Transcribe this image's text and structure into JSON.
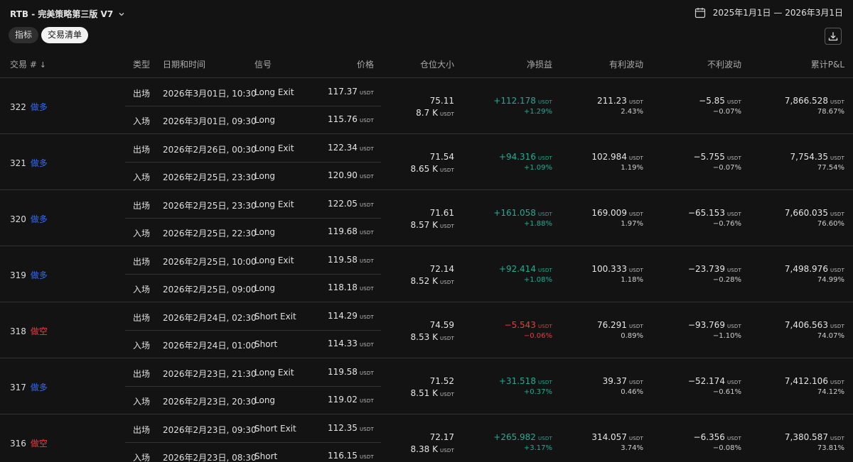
{
  "header": {
    "strategy_title": "RTB - 完美策略第三版 V7",
    "date_range": "2025年1月1日 — 2026年3月1日"
  },
  "tabs": [
    {
      "label": "指标",
      "active": false
    },
    {
      "label": "交易清单",
      "active": true
    }
  ],
  "unit": "USDT",
  "columns": {
    "trade_no": "交易 #",
    "type": "类型",
    "datetime": "日期和时间",
    "signal": "信号",
    "price": "价格",
    "size": "仓位大小",
    "net_pnl": "净损益",
    "favorable": "有利波动",
    "adverse": "不利波动",
    "cum_pnl": "累计P&L"
  },
  "colors": {
    "long": "#2f6bff",
    "short": "#f23645",
    "profit": "#22ab94",
    "loss": "#f23645"
  },
  "trades": [
    {
      "no": "322",
      "dir": "做多",
      "dir_class": "long",
      "exit": {
        "type": "出场",
        "datetime": "2026年3月01日, 10:30",
        "signal": "Long Exit",
        "price": "117.37"
      },
      "entry": {
        "type": "入场",
        "datetime": "2026年3月01日, 09:30",
        "signal": "Long",
        "price": "115.76"
      },
      "size_qty": "75.11",
      "size_value": "8.7 K",
      "net_pnl": "+112.178",
      "net_pnl_pct": "+1.29%",
      "pnl_class": "pos",
      "favorable": "211.23",
      "favorable_pct": "2.43%",
      "adverse": "−5.85",
      "adverse_pct": "−0.07%",
      "cum_pnl": "7,866.528",
      "cum_pnl_pct": "78.67%"
    },
    {
      "no": "321",
      "dir": "做多",
      "dir_class": "long",
      "exit": {
        "type": "出场",
        "datetime": "2026年2月26日, 00:30",
        "signal": "Long Exit",
        "price": "122.34"
      },
      "entry": {
        "type": "入场",
        "datetime": "2026年2月25日, 23:30",
        "signal": "Long",
        "price": "120.90"
      },
      "size_qty": "71.54",
      "size_value": "8.65 K",
      "net_pnl": "+94.316",
      "net_pnl_pct": "+1.09%",
      "pnl_class": "pos",
      "favorable": "102.984",
      "favorable_pct": "1.19%",
      "adverse": "−5.755",
      "adverse_pct": "−0.07%",
      "cum_pnl": "7,754.35",
      "cum_pnl_pct": "77.54%"
    },
    {
      "no": "320",
      "dir": "做多",
      "dir_class": "long",
      "exit": {
        "type": "出场",
        "datetime": "2026年2月25日, 23:30",
        "signal": "Long Exit",
        "price": "122.05"
      },
      "entry": {
        "type": "入场",
        "datetime": "2026年2月25日, 22:30",
        "signal": "Long",
        "price": "119.68"
      },
      "size_qty": "71.61",
      "size_value": "8.57 K",
      "net_pnl": "+161.058",
      "net_pnl_pct": "+1.88%",
      "pnl_class": "pos",
      "favorable": "169.009",
      "favorable_pct": "1.97%",
      "adverse": "−65.153",
      "adverse_pct": "−0.76%",
      "cum_pnl": "7,660.035",
      "cum_pnl_pct": "76.60%"
    },
    {
      "no": "319",
      "dir": "做多",
      "dir_class": "long",
      "exit": {
        "type": "出场",
        "datetime": "2026年2月25日, 10:00",
        "signal": "Long Exit",
        "price": "119.58"
      },
      "entry": {
        "type": "入场",
        "datetime": "2026年2月25日, 09:00",
        "signal": "Long",
        "price": "118.18"
      },
      "size_qty": "72.14",
      "size_value": "8.52 K",
      "net_pnl": "+92.414",
      "net_pnl_pct": "+1.08%",
      "pnl_class": "pos",
      "favorable": "100.333",
      "favorable_pct": "1.18%",
      "adverse": "−23.739",
      "adverse_pct": "−0.28%",
      "cum_pnl": "7,498.976",
      "cum_pnl_pct": "74.99%"
    },
    {
      "no": "318",
      "dir": "做空",
      "dir_class": "short",
      "exit": {
        "type": "出场",
        "datetime": "2026年2月24日, 02:30",
        "signal": "Short Exit",
        "price": "114.29"
      },
      "entry": {
        "type": "入场",
        "datetime": "2026年2月24日, 01:00",
        "signal": "Short",
        "price": "114.33"
      },
      "size_qty": "74.59",
      "size_value": "8.53 K",
      "net_pnl": "−5.543",
      "net_pnl_pct": "−0.06%",
      "pnl_class": "neg",
      "favorable": "76.291",
      "favorable_pct": "0.89%",
      "adverse": "−93.769",
      "adverse_pct": "−1.10%",
      "cum_pnl": "7,406.563",
      "cum_pnl_pct": "74.07%"
    },
    {
      "no": "317",
      "dir": "做多",
      "dir_class": "long",
      "exit": {
        "type": "出场",
        "datetime": "2026年2月23日, 21:30",
        "signal": "Long Exit",
        "price": "119.58"
      },
      "entry": {
        "type": "入场",
        "datetime": "2026年2月23日, 20:30",
        "signal": "Long",
        "price": "119.02"
      },
      "size_qty": "71.52",
      "size_value": "8.51 K",
      "net_pnl": "+31.518",
      "net_pnl_pct": "+0.37%",
      "pnl_class": "pos",
      "favorable": "39.37",
      "favorable_pct": "0.46%",
      "adverse": "−52.174",
      "adverse_pct": "−0.61%",
      "cum_pnl": "7,412.106",
      "cum_pnl_pct": "74.12%"
    },
    {
      "no": "316",
      "dir": "做空",
      "dir_class": "short",
      "exit": {
        "type": "出场",
        "datetime": "2026年2月23日, 09:30",
        "signal": "Short Exit",
        "price": "112.35"
      },
      "entry": {
        "type": "入场",
        "datetime": "2026年2月23日, 08:30",
        "signal": "Short",
        "price": "116.15"
      },
      "size_qty": "72.17",
      "size_value": "8.38 K",
      "net_pnl": "+265.982",
      "net_pnl_pct": "+3.17%",
      "pnl_class": "pos",
      "favorable": "314.057",
      "favorable_pct": "3.74%",
      "adverse": "−6.356",
      "adverse_pct": "−0.08%",
      "cum_pnl": "7,380.587",
      "cum_pnl_pct": "73.81%"
    }
  ]
}
